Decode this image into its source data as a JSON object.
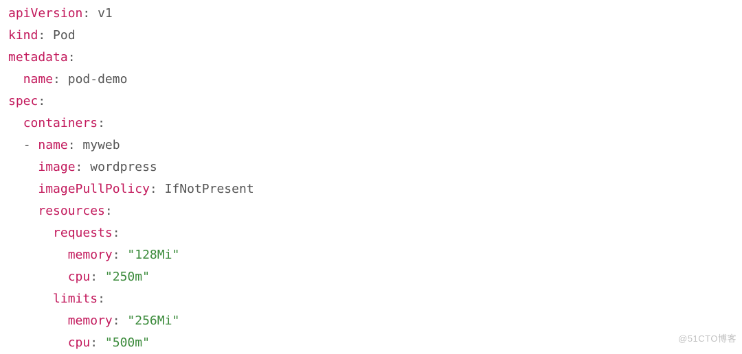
{
  "yaml": {
    "l01": {
      "key": "apiVersion",
      "val": "v1"
    },
    "l02": {
      "key": "kind",
      "val": "Pod"
    },
    "l03": {
      "key": "metadata"
    },
    "l04": {
      "key": "name",
      "val": "pod-demo"
    },
    "l05": {
      "key": "spec"
    },
    "l06": {
      "key": "containers"
    },
    "l07": {
      "key": "name",
      "val": "myweb",
      "dash": "- "
    },
    "l08": {
      "key": "image",
      "val": "wordpress"
    },
    "l09": {
      "key": "imagePullPolicy",
      "val": "IfNotPresent"
    },
    "l10": {
      "key": "resources"
    },
    "l11": {
      "key": "requests"
    },
    "l12": {
      "key": "memory",
      "val": "\"128Mi\""
    },
    "l13": {
      "key": "cpu",
      "val": "\"250m\""
    },
    "l14": {
      "key": "limits"
    },
    "l15": {
      "key": "memory",
      "val": "\"256Mi\""
    },
    "l16": {
      "key": "cpu",
      "val": "\"500m\""
    }
  },
  "colon": ":",
  "colon_space": ": ",
  "watermark": "@51CTO博客"
}
